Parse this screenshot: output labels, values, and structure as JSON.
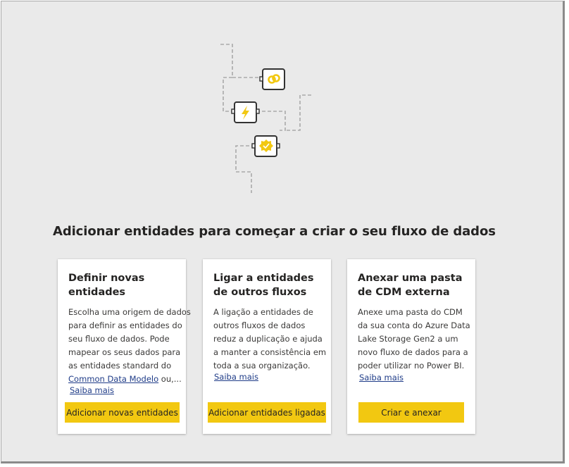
{
  "headline": "Adicionar entidades para começar a criar o seu fluxo de dados",
  "illustration": {
    "icons": [
      "link-icon",
      "lightning-icon",
      "certified-badge-icon"
    ],
    "accent_color": "#f2c811",
    "line_color": "#a9a9a9"
  },
  "cards": [
    {
      "title_lines": [
        "Definir novas",
        "entidades"
      ],
      "desc_lines": [
        "Escolha uma origem de dados",
        "para definir as entidades do",
        "seu fluxo de dados. Pode",
        "mapear os seus dados para",
        "as entidades standard do"
      ],
      "desc_link": "Common Data Modelo",
      "desc_after_link": " ou,...",
      "learn_more": "Saiba mais",
      "button": "Adicionar novas entidades"
    },
    {
      "title_lines": [
        "Ligar a entidades",
        "de outros fluxos"
      ],
      "desc_lines": [
        "A ligação a entidades de",
        "outros fluxos de dados",
        "reduz a duplicação e ajuda",
        "a manter a consistência em",
        "toda a sua organização."
      ],
      "learn_more": "Saiba mais",
      "button": "Adicionar entidades ligadas"
    },
    {
      "title_lines": [
        "Anexar uma pasta",
        "de CDM externa"
      ],
      "desc_lines": [
        "Anexe uma pasta do CDM",
        "da sua conta do Azure Data",
        "Lake Storage Gen2 a um",
        "novo fluxo de dados para a",
        "poder utilizar no Power BI."
      ],
      "learn_more": "Saiba mais",
      "button": "Criar e anexar"
    }
  ],
  "colors": {
    "background": "#eaeaea",
    "button": "#f2c811",
    "link": "#1f3c88",
    "card": "#ffffff"
  }
}
